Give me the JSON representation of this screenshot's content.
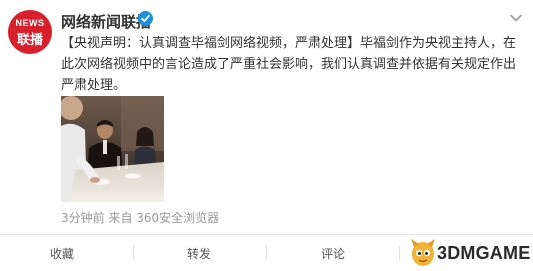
{
  "account": {
    "name": "网络新闻联播",
    "avatar_text_top": "NEWS",
    "avatar_text_bottom": "联播"
  },
  "post": {
    "lines": [
      "【央视声明：认真调查毕福剑网络视频，严肃处理】毕福剑作为央视主持人，在",
      "此次网络视频中的言论造成了严重社会影响，我们认真调查并依据有关规定作出",
      "严肃处理。"
    ],
    "meta": "3分钟前 来自 360安全浏览器"
  },
  "actions": {
    "favorite": "收藏",
    "repost": "转发",
    "comment": "评论"
  },
  "watermark": {
    "text": "3DMGAME"
  },
  "colors": {
    "brand_red": "#d8202c",
    "verified_blue": "#1e90e0",
    "meta_gray": "#999999"
  },
  "icons": [
    "verified-badge-icon",
    "chevron-down-icon"
  ]
}
